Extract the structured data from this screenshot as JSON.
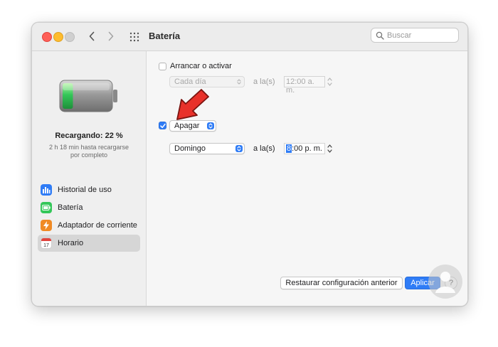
{
  "window": {
    "title": "Batería"
  },
  "search": {
    "placeholder": "Buscar"
  },
  "battery": {
    "status": "Recargando: 22 %",
    "remaining_line1": "2 h 18 min hasta recargarse",
    "remaining_line2": "por completo",
    "level_fraction": 0.22
  },
  "sidebar": {
    "items": [
      {
        "label": "Historial de uso",
        "icon": "bar-chart-icon",
        "color": "#2f7cf6",
        "selected": false
      },
      {
        "label": "Batería",
        "icon": "battery-icon",
        "color": "#34c759",
        "selected": false
      },
      {
        "label": "Adaptador de corriente",
        "icon": "bolt-icon",
        "color": "#f08a24",
        "selected": false
      },
      {
        "label": "Horario",
        "icon": "calendar-icon",
        "color": "#e0443e",
        "selected": true
      }
    ]
  },
  "schedule": {
    "startup": {
      "label": "Arrancar o activar",
      "checked": false,
      "frequency": "Cada día",
      "at_label": "a la(s)",
      "time": "12:00 a. m."
    },
    "shutdown": {
      "action": "Apagar",
      "checked": true,
      "frequency": "Domingo",
      "at_label": "a la(s)",
      "time_hour": "8",
      "time_rest": ":00 p. m."
    }
  },
  "buttons": {
    "restore": "Restaurar configuración anterior",
    "apply": "Aplicar",
    "help": "?"
  },
  "colors": {
    "accent": "#2f7cf6",
    "battery_green": "#34c759",
    "arrow_red": "#e8312a"
  }
}
